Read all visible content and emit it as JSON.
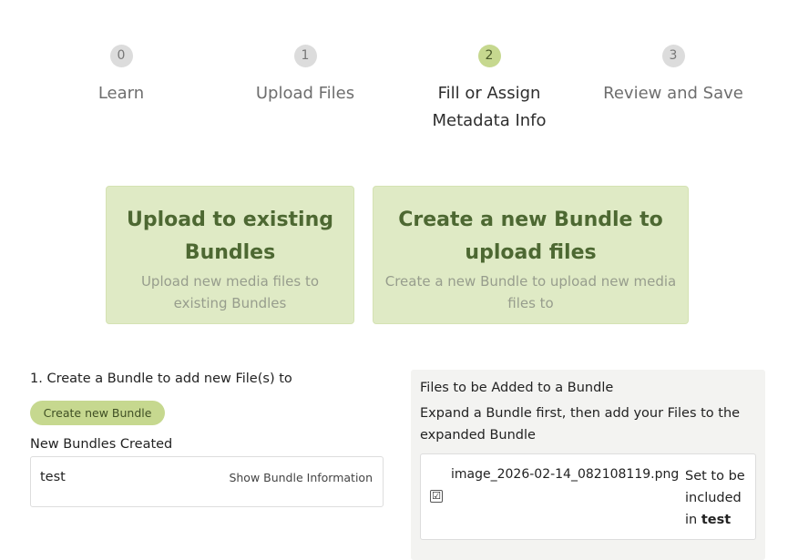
{
  "steps": [
    {
      "num": "0",
      "label": "Learn"
    },
    {
      "num": "1",
      "label": "Upload Files"
    },
    {
      "num": "2",
      "label_line1": "Fill or Assign",
      "label_line2": "Metadata Info",
      "active": true
    },
    {
      "num": "3",
      "label": "Review and Save"
    }
  ],
  "options": {
    "existing": {
      "title_line1": "Upload to existing",
      "title_line2": "Bundles",
      "desc_line1": "Upload new media files to",
      "desc_line2": "existing Bundles"
    },
    "new_bundle": {
      "title_line1": "Create a new Bundle to",
      "title_line2": "upload files",
      "desc_line1": "Create a new Bundle to upload new media",
      "desc_line2": "files to"
    }
  },
  "create_section": {
    "title": "1. Create a Bundle to add new File(s) to",
    "create_button": "Create new Bundle",
    "created_title": "New Bundles Created",
    "bundles": [
      {
        "name": "test",
        "info_link": "Show Bundle Information"
      }
    ]
  },
  "files_panel": {
    "title": "Files to be Added to a Bundle",
    "hint_line1": "Expand a Bundle first, then add your Files to the",
    "hint_line2": "expanded Bundle",
    "files": [
      {
        "checked": "☑",
        "name": "image_2026-02-14_082108119.png",
        "status_line1": "Set to be",
        "status_line2": "included",
        "status_prefix": "in",
        "status_bundle": "test"
      }
    ]
  },
  "colors": {
    "accent": "#c6d88f",
    "card_bg": "#dfeac5",
    "card_title": "#4d6832",
    "panel_bg": "#f3f3f1"
  }
}
